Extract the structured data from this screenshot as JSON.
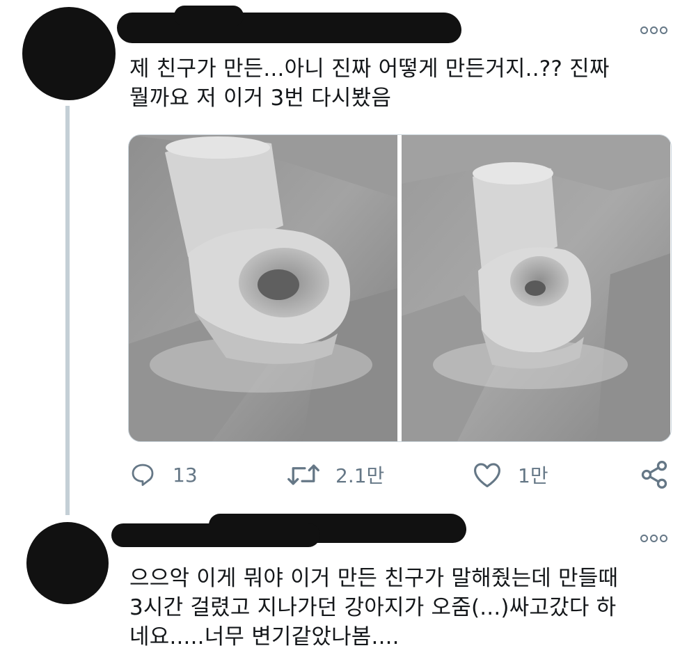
{
  "tweets": [
    {
      "more_icon": "more-options-icon",
      "text_lines": [
        "제 친구가 만든...아니 진짜 어떻게 만든거지..?? 진짜",
        "뭘까요 저 이거 3번 다시봤음"
      ],
      "media_alt": [
        "toilet-shaped clay sculpture photo",
        "toilet-shaped clay sculpture photo"
      ],
      "actions": {
        "reply": {
          "icon": "reply-icon",
          "count": "13"
        },
        "retweet": {
          "icon": "retweet-icon",
          "count": "2.1만"
        },
        "like": {
          "icon": "heart-icon",
          "count": "1만"
        },
        "share": {
          "icon": "share-icon"
        }
      }
    },
    {
      "more_icon": "more-options-icon",
      "text_lines": [
        "으으악 이게 뭐야 이거 만든 친구가 말해줬는데 만들때",
        "3시간 걸렸고 지나가던 강아지가 오줌(...)싸고갔다 하",
        "네요.....너무 변기같았나봄...."
      ]
    }
  ],
  "colors": {
    "text": "#14171a",
    "secondary": "#657786",
    "thread_line": "#c4cfd6",
    "redaction": "#111111"
  }
}
